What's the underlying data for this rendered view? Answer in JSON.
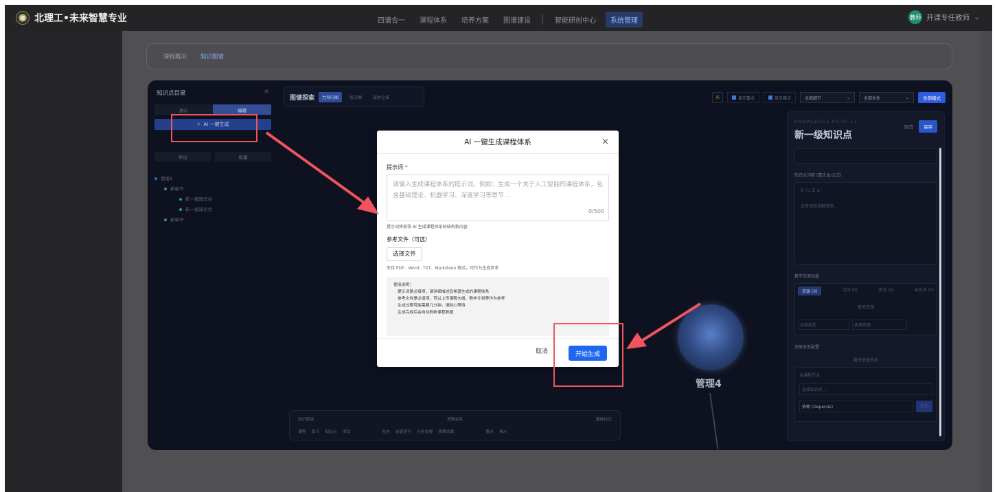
{
  "app": {
    "title": "北理工•未来智慧专业"
  },
  "nav": {
    "items": [
      "四谱合一",
      "课程体系",
      "培养方案",
      "图谱建设",
      "智能研创中心",
      "系统管理"
    ],
    "active": "系统管理"
  },
  "user": {
    "badge": "教师",
    "name": "开课专任教师"
  },
  "subtabs": [
    "课程概况",
    "知识图谱"
  ],
  "left_panel": {
    "title": "知识点目录",
    "seg": [
      "展示",
      "编辑"
    ],
    "ai_button": "AI 一键生成",
    "buttons": [
      "导出",
      "批量"
    ],
    "tree": [
      "管理4",
      "新章节",
      "新一级知识点",
      "新一级知识点",
      "新章节"
    ]
  },
  "graph_toolbar": {
    "title": "图谱探索",
    "modes": [
      "力导向图",
      "层次图",
      "放射全景"
    ]
  },
  "top_right": {
    "check1": "显示重点",
    "check2": "显示难点",
    "select1": "全部细节",
    "select2": "全部关系",
    "format_button": "全部模式"
  },
  "right_panel": {
    "kp": "KNOWLEDGE POINT",
    "level": "L1",
    "title": "新一级知识点",
    "cancel": "取消",
    "save": "保存",
    "detail_label": "知识点详解 (富文本/公式)",
    "placeholder": "点击添加详细说明...",
    "resources_label": "教学资源挂载",
    "res_tabs": [
      "资源 (0)",
      "活动 (0)",
      "测试 (0)",
      "AI实训 (0)"
    ],
    "empty_res": "暂无资源",
    "type_select": "全部类型",
    "choose_res": "选择资源...",
    "relations_label": "关联关系配置",
    "no_relations": "暂无关联关系",
    "this_node": "本课程节点",
    "choose_kp": "选择知识点...",
    "depends": "依赖 (Depends)",
    "add": "添加"
  },
  "legend": {
    "node_type": "知识层级",
    "node_items": [
      "课程",
      "章节",
      "知识点",
      "项目"
    ],
    "logic": "逻辑关系",
    "logic_items": [
      "包含",
      "前驱序列",
      "应用支撑",
      "依赖关联"
    ],
    "tags": "属性标记",
    "tag_items": [
      "重点",
      "难点"
    ]
  },
  "node": {
    "label": "管理4"
  },
  "modal": {
    "title": "AI 一键生成课程体系",
    "close": "×",
    "prompt_label": "提示词",
    "prompt_placeholder": "请输入生成课程体系的提示词，例如：生成一个关于人工智能的课程体系，包含基础理论、机器学习、深度学习等章节...",
    "counter": "0/500",
    "prompt_hint": "提示词将指导 AI 生成课程体系的结构和内容",
    "file_label": "参考文件（可选）",
    "file_button": "选择文件",
    "file_hint": "支持 PDF、Word、TXT、Markdown 格式，可作为生成参考",
    "usage_title": "使用说明：",
    "usage": [
      "提示词是必填项，请详细描述您希望生成的课程体系",
      "参考文件是必填项，可以上传课程大纲、教学计划等作为参考",
      "生成过程可能需要几分钟，请耐心等待",
      "生成完成后会自动刷新课程数据"
    ],
    "cancel": "取消",
    "submit": "开始生成"
  },
  "colors": {
    "accent": "#1f66f0",
    "annotation": "#f1545d"
  }
}
